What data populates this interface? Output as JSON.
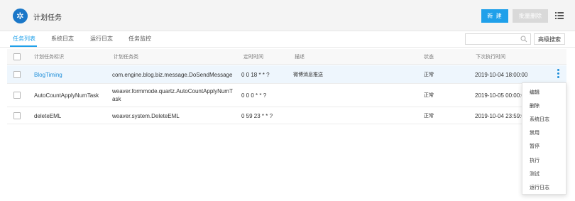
{
  "header": {
    "logo_icon": "gear-icon",
    "title": "计划任务",
    "new_label": "新 建",
    "bulk_delete_label": "批量删除",
    "menu_icon": "list-icon"
  },
  "tabs": [
    {
      "label": "任务列表",
      "active": true
    },
    {
      "label": "系统日志",
      "active": false
    },
    {
      "label": "运行日志",
      "active": false
    },
    {
      "label": "任务监控",
      "active": false
    }
  ],
  "search": {
    "placeholder": "",
    "advanced_label": "高级搜索"
  },
  "table": {
    "columns": [
      "计划任务标识",
      "计划任务类",
      "定时时间",
      "描述",
      "状态",
      "下次执行时间"
    ],
    "rows": [
      {
        "id": "BlogTiming",
        "class": "com.engine.blog.biz.message.DoSendMessage",
        "cron": "0 0 18 * * ?",
        "desc": "微博消息推送",
        "status": "正常",
        "next": "2019-10-04 18:00:00"
      },
      {
        "id": "AutoCountApplyNumTask",
        "class_line1": "weaver.formmode.quartz.AutoCountApplyNumT",
        "class_line2": "ask",
        "cron": "0 0 0 * * ?",
        "desc": "",
        "status": "正常",
        "next": "2019-10-05 00:00:0"
      },
      {
        "id": "deleteEML",
        "class": "weaver.system.DeleteEML",
        "cron": "0 59 23 * * ?",
        "desc": "",
        "status": "正常",
        "next": "2019-10-04 23:59:0"
      }
    ]
  },
  "row_menu": [
    "编辑",
    "删除",
    "系统日志",
    "禁用",
    "暂停",
    "执行",
    "测试",
    "运行日志"
  ],
  "colors": {
    "accent": "#1fa0ea",
    "link": "#1f8fd9",
    "logo": "#1a77c8"
  }
}
